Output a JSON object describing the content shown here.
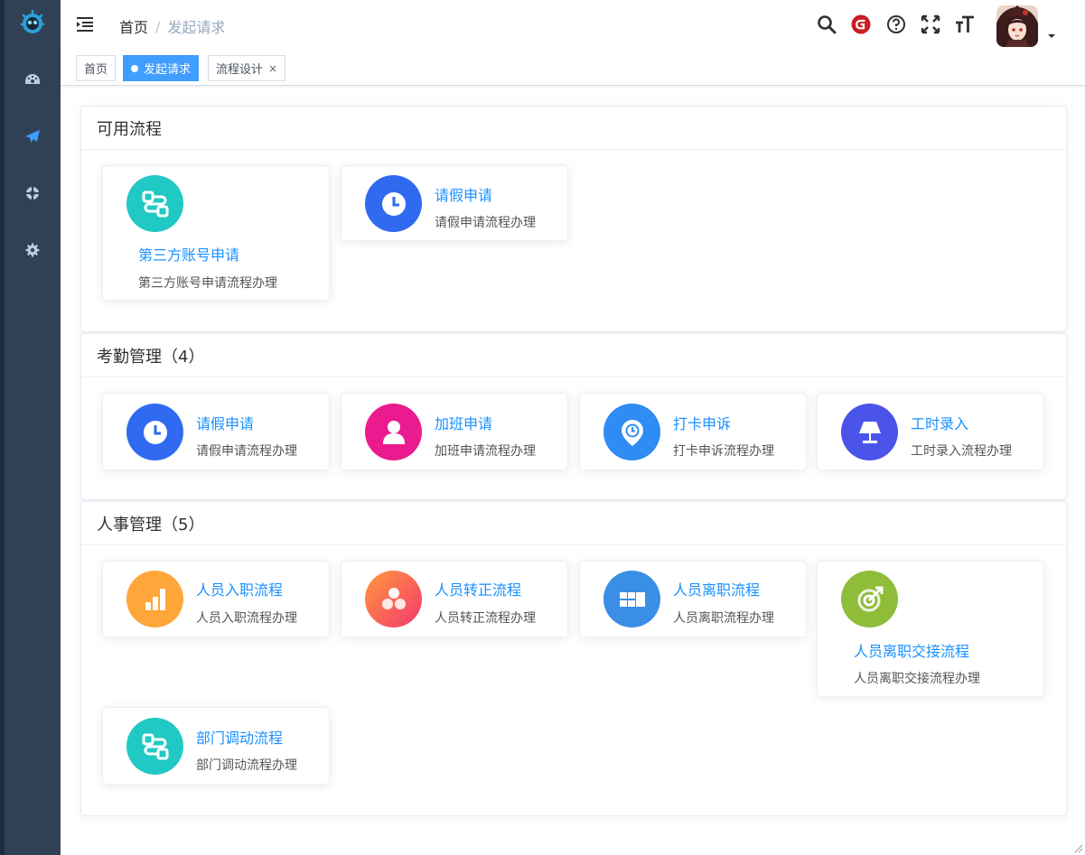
{
  "navbar": {
    "breadcrumb": {
      "home": "首页",
      "separator": "/",
      "current": "发起请求"
    },
    "icons": [
      "menu-fold-icon",
      "search-icon",
      "gitee-icon",
      "question-icon",
      "fullscreen-icon",
      "font-size-icon"
    ]
  },
  "sidebar": {
    "icons": [
      "dashboard-icon",
      "send-icon",
      "lifebuoy-icon",
      "gear-icon"
    ]
  },
  "tags": [
    {
      "label": "首页",
      "active": false
    },
    {
      "label": "发起请求",
      "active": true
    },
    {
      "label": "流程设计",
      "active": false,
      "closable": true,
      "close_glyph": "×"
    }
  ],
  "colors": {
    "accent": "#1890ff",
    "tag_active": "#42b983",
    "sidebar": "#304156"
  },
  "sections": [
    {
      "title": "可用流程",
      "items": [
        {
          "title": "第三方账号申请",
          "desc": "第三方账号申请流程办理",
          "icon": "flow-icon",
          "color": "#20c9c4"
        },
        {
          "title": "请假申请",
          "desc": "请假申请流程办理",
          "icon": "clock-icon",
          "color": "#2f6af1"
        }
      ]
    },
    {
      "title": "考勤管理（4）",
      "items": [
        {
          "title": "请假申请",
          "desc": "请假申请流程办理",
          "icon": "clock-icon",
          "color": "#2f6af1"
        },
        {
          "title": "加班申请",
          "desc": "加班申请流程办理",
          "icon": "user-icon",
          "color": "#ea1b8f"
        },
        {
          "title": "打卡申诉",
          "desc": "打卡申诉流程办理",
          "icon": "location-clock-icon",
          "color": "#2f8cf4"
        },
        {
          "title": "工时录入",
          "desc": "工时录入流程办理",
          "icon": "lamp-icon",
          "color": "#4b54e8"
        }
      ]
    },
    {
      "title": "人事管理（5）",
      "items": [
        {
          "title": "人员入职流程",
          "desc": "人员入职流程办理",
          "icon": "bar-chart-icon",
          "color": "#ffa63a"
        },
        {
          "title": "人员转正流程",
          "desc": "人员转正流程办理",
          "icon": "three-circles-icon",
          "color": "#fd5a6a"
        },
        {
          "title": "人员离职流程",
          "desc": "人员离职流程办理",
          "icon": "grid-blocks-icon",
          "color": "#3a8ee6"
        },
        {
          "title": "人员离职交接流程",
          "desc": "人员离职交接流程办理",
          "icon": "target-icon",
          "color": "#8fbd3a"
        },
        {
          "title": "部门调动流程",
          "desc": "部门调动流程办理",
          "icon": "flow-icon",
          "color": "#20c9c4"
        }
      ]
    }
  ]
}
